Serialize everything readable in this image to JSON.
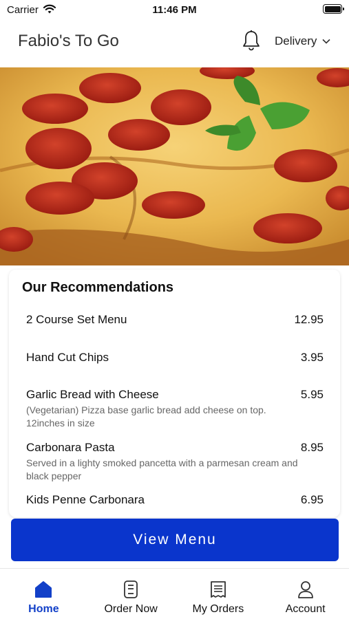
{
  "status_bar": {
    "carrier": "Carrier",
    "time": "11:46 PM"
  },
  "header": {
    "title": "Fabio's To Go",
    "delivery_label": "Delivery",
    "bell_icon": "bell-icon"
  },
  "recommendations": {
    "title": "Our Recommendations",
    "items": [
      {
        "name": "2 Course Set Menu",
        "price": "12.95",
        "description": ""
      },
      {
        "name": "Hand Cut Chips",
        "price": "3.95",
        "description": ""
      },
      {
        "name": "Garlic Bread with Cheese",
        "price": "5.95",
        "description": "(Vegetarian) Pizza base garlic bread add cheese on top. 12inches in size"
      },
      {
        "name": "Carbonara Pasta",
        "price": "8.95",
        "description": "Served in a lighty smoked pancetta with a parmesan cream and black pepper"
      },
      {
        "name": "Kids Penne Carbonara",
        "price": "6.95",
        "description": ""
      }
    ]
  },
  "cta": {
    "label": "View Menu",
    "color": "#0a35cc"
  },
  "tabs": [
    {
      "label": "Home",
      "icon": "home-icon",
      "active": true
    },
    {
      "label": "Order Now",
      "icon": "order-icon",
      "active": false
    },
    {
      "label": "My Orders",
      "icon": "receipt-icon",
      "active": false
    },
    {
      "label": "Account",
      "icon": "account-icon",
      "active": false
    }
  ]
}
